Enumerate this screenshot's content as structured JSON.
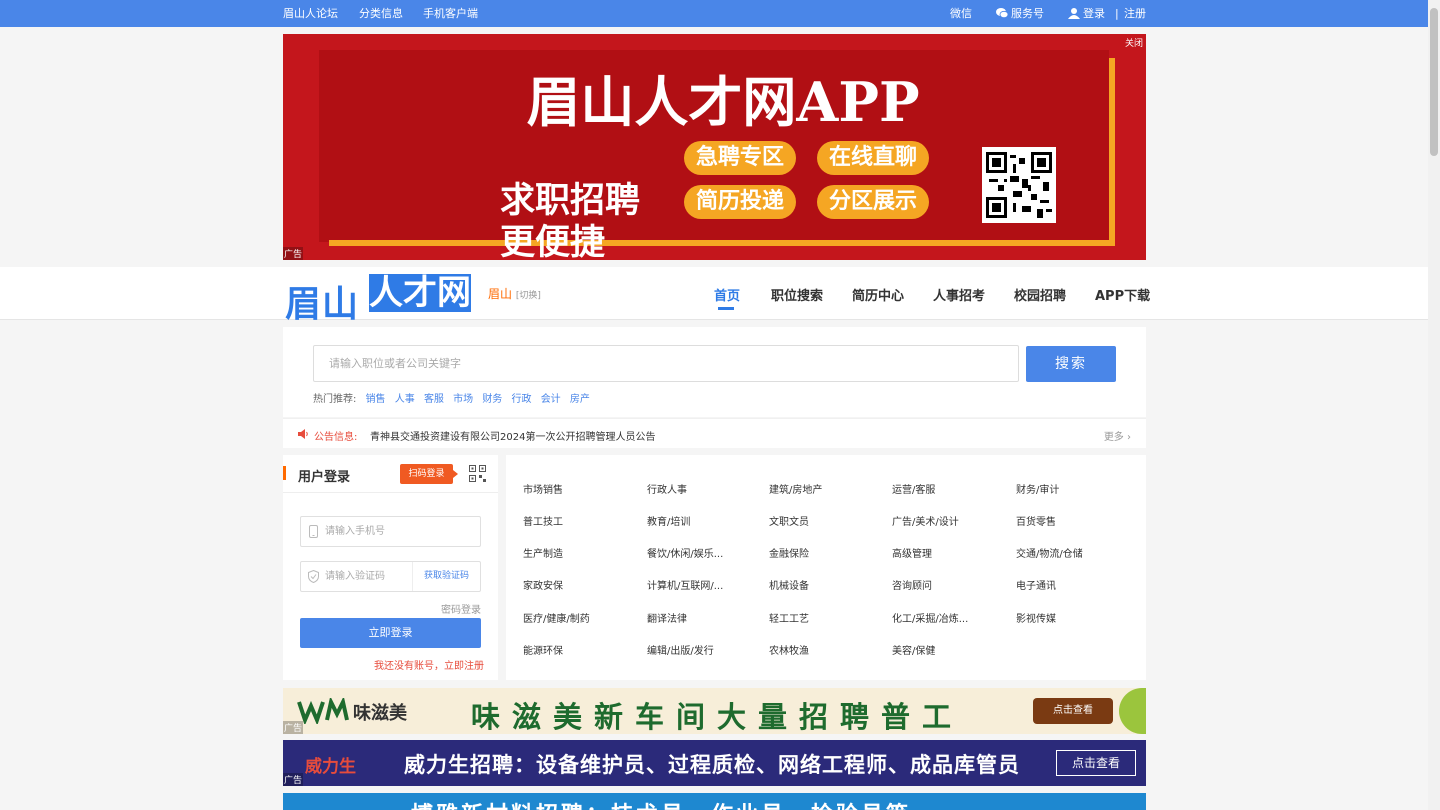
{
  "topbar": {
    "links": [
      "眉山人论坛",
      "分类信息",
      "手机客户端"
    ],
    "weixin": "微信",
    "service": "服务号",
    "login": "登录",
    "sep": "|",
    "register": "注册"
  },
  "banner": {
    "title": "眉山人才网APP",
    "slogan_line1": "求职招聘",
    "slogan_line2": "更便捷",
    "pills": [
      "急聘专区",
      "在线直聊",
      "简历投递",
      "分区展示"
    ],
    "close": "关闭",
    "ad_label": "广告"
  },
  "header": {
    "logo_part1": "眉山",
    "logo_part2": "人才网",
    "city": "眉山",
    "city_switch": "[切换]",
    "nav": [
      "首页",
      "职位搜索",
      "简历中心",
      "人事招考",
      "校园招聘",
      "APP下载"
    ]
  },
  "search": {
    "placeholder": "请输入职位或者公司关键字",
    "button": "搜索",
    "hot_label": "热门推荐:",
    "hot_tags": [
      "销售",
      "人事",
      "客服",
      "市场",
      "财务",
      "行政",
      "会计",
      "房产"
    ]
  },
  "notice": {
    "label": "公告信息:",
    "message": "青神县交通投资建设有限公司2024第一次公开招聘管理人员公告",
    "more": "更多 ›"
  },
  "login": {
    "title": "用户登录",
    "scan": "扫码登录",
    "phone_placeholder": "请输入手机号",
    "code_placeholder": "请输入验证码",
    "get_code": "获取验证码",
    "password_login": "密码登录",
    "submit": "立即登录",
    "register_hint": "我还没有账号，立即注册"
  },
  "categories": [
    [
      "市场销售",
      "行政人事",
      "建筑/房地产",
      "运营/客服",
      "财务/审计"
    ],
    [
      "普工技工",
      "教育/培训",
      "文职文员",
      "广告/美术/设计",
      "百货零售"
    ],
    [
      "生产制造",
      "餐饮/休闲/娱乐...",
      "金融保险",
      "高级管理",
      "交通/物流/仓储"
    ],
    [
      "家政安保",
      "计算机/互联网/...",
      "机械设备",
      "咨询顾问",
      "电子通讯"
    ],
    [
      "医疗/健康/制药",
      "翻译法律",
      "轻工工艺",
      "化工/采掘/冶炼...",
      "影视传媒"
    ],
    [
      "能源环保",
      "编辑/出版/发行",
      "农林牧渔",
      "美容/保健"
    ]
  ],
  "ads": {
    "ad1_logo": "味滋美",
    "ad1_text": "味滋美新车间大量招聘普工",
    "ad1_button": "点击查看",
    "ad2_logo": "威力生",
    "ad2_text": "威力生招聘：设备维护员、过程质检、网络工程师、成品库管员",
    "ad2_button": "点击查看",
    "ad3_text": "博雅新材料招聘：技术员、作业员、检验员等",
    "ad_label": "广告"
  },
  "colors": {
    "accent": "#4a86e8",
    "banner_red": "#c4161c",
    "gold": "#f5a623",
    "orange": "#ff6a00"
  }
}
